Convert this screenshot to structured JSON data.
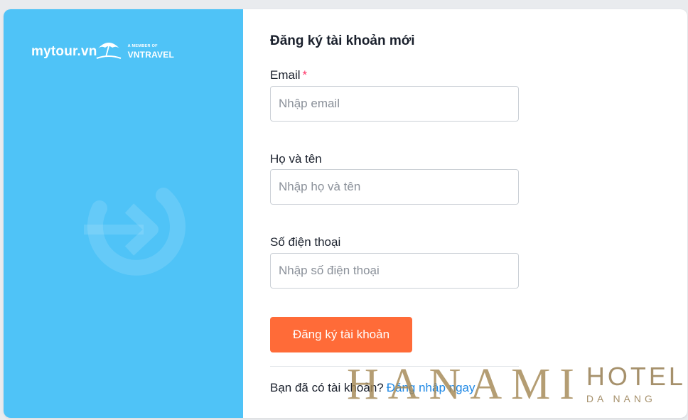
{
  "brand": {
    "logo_text": "mytour.vn",
    "member_of": "A MEMBER OF",
    "member_brand": "VNTRAVEL"
  },
  "form": {
    "title": "Đăng ký tài khoản mới",
    "email": {
      "label": "Email",
      "required_mark": "*",
      "placeholder": "Nhập email",
      "value": ""
    },
    "full_name": {
      "label": "Họ và tên",
      "placeholder": "Nhập họ và tên",
      "value": ""
    },
    "phone": {
      "label": "Số điện thoại",
      "placeholder": "Nhập số điện thoại",
      "value": ""
    },
    "submit_label": "Đăng ký tài khoản",
    "login_prompt": "Bạn đã có tài khoản?",
    "login_link": "Đăng nhập ngay"
  },
  "watermark": {
    "name": "HANAMI",
    "hotel": "HOTEL",
    "city": "DA NANG"
  },
  "colors": {
    "left_panel": "#4fc3f7",
    "submit": "#ff6b38",
    "link": "#1e88e5",
    "required": "#ff3366"
  },
  "icons": [
    "umbrella-logo-icon",
    "login-arrow-icon"
  ]
}
